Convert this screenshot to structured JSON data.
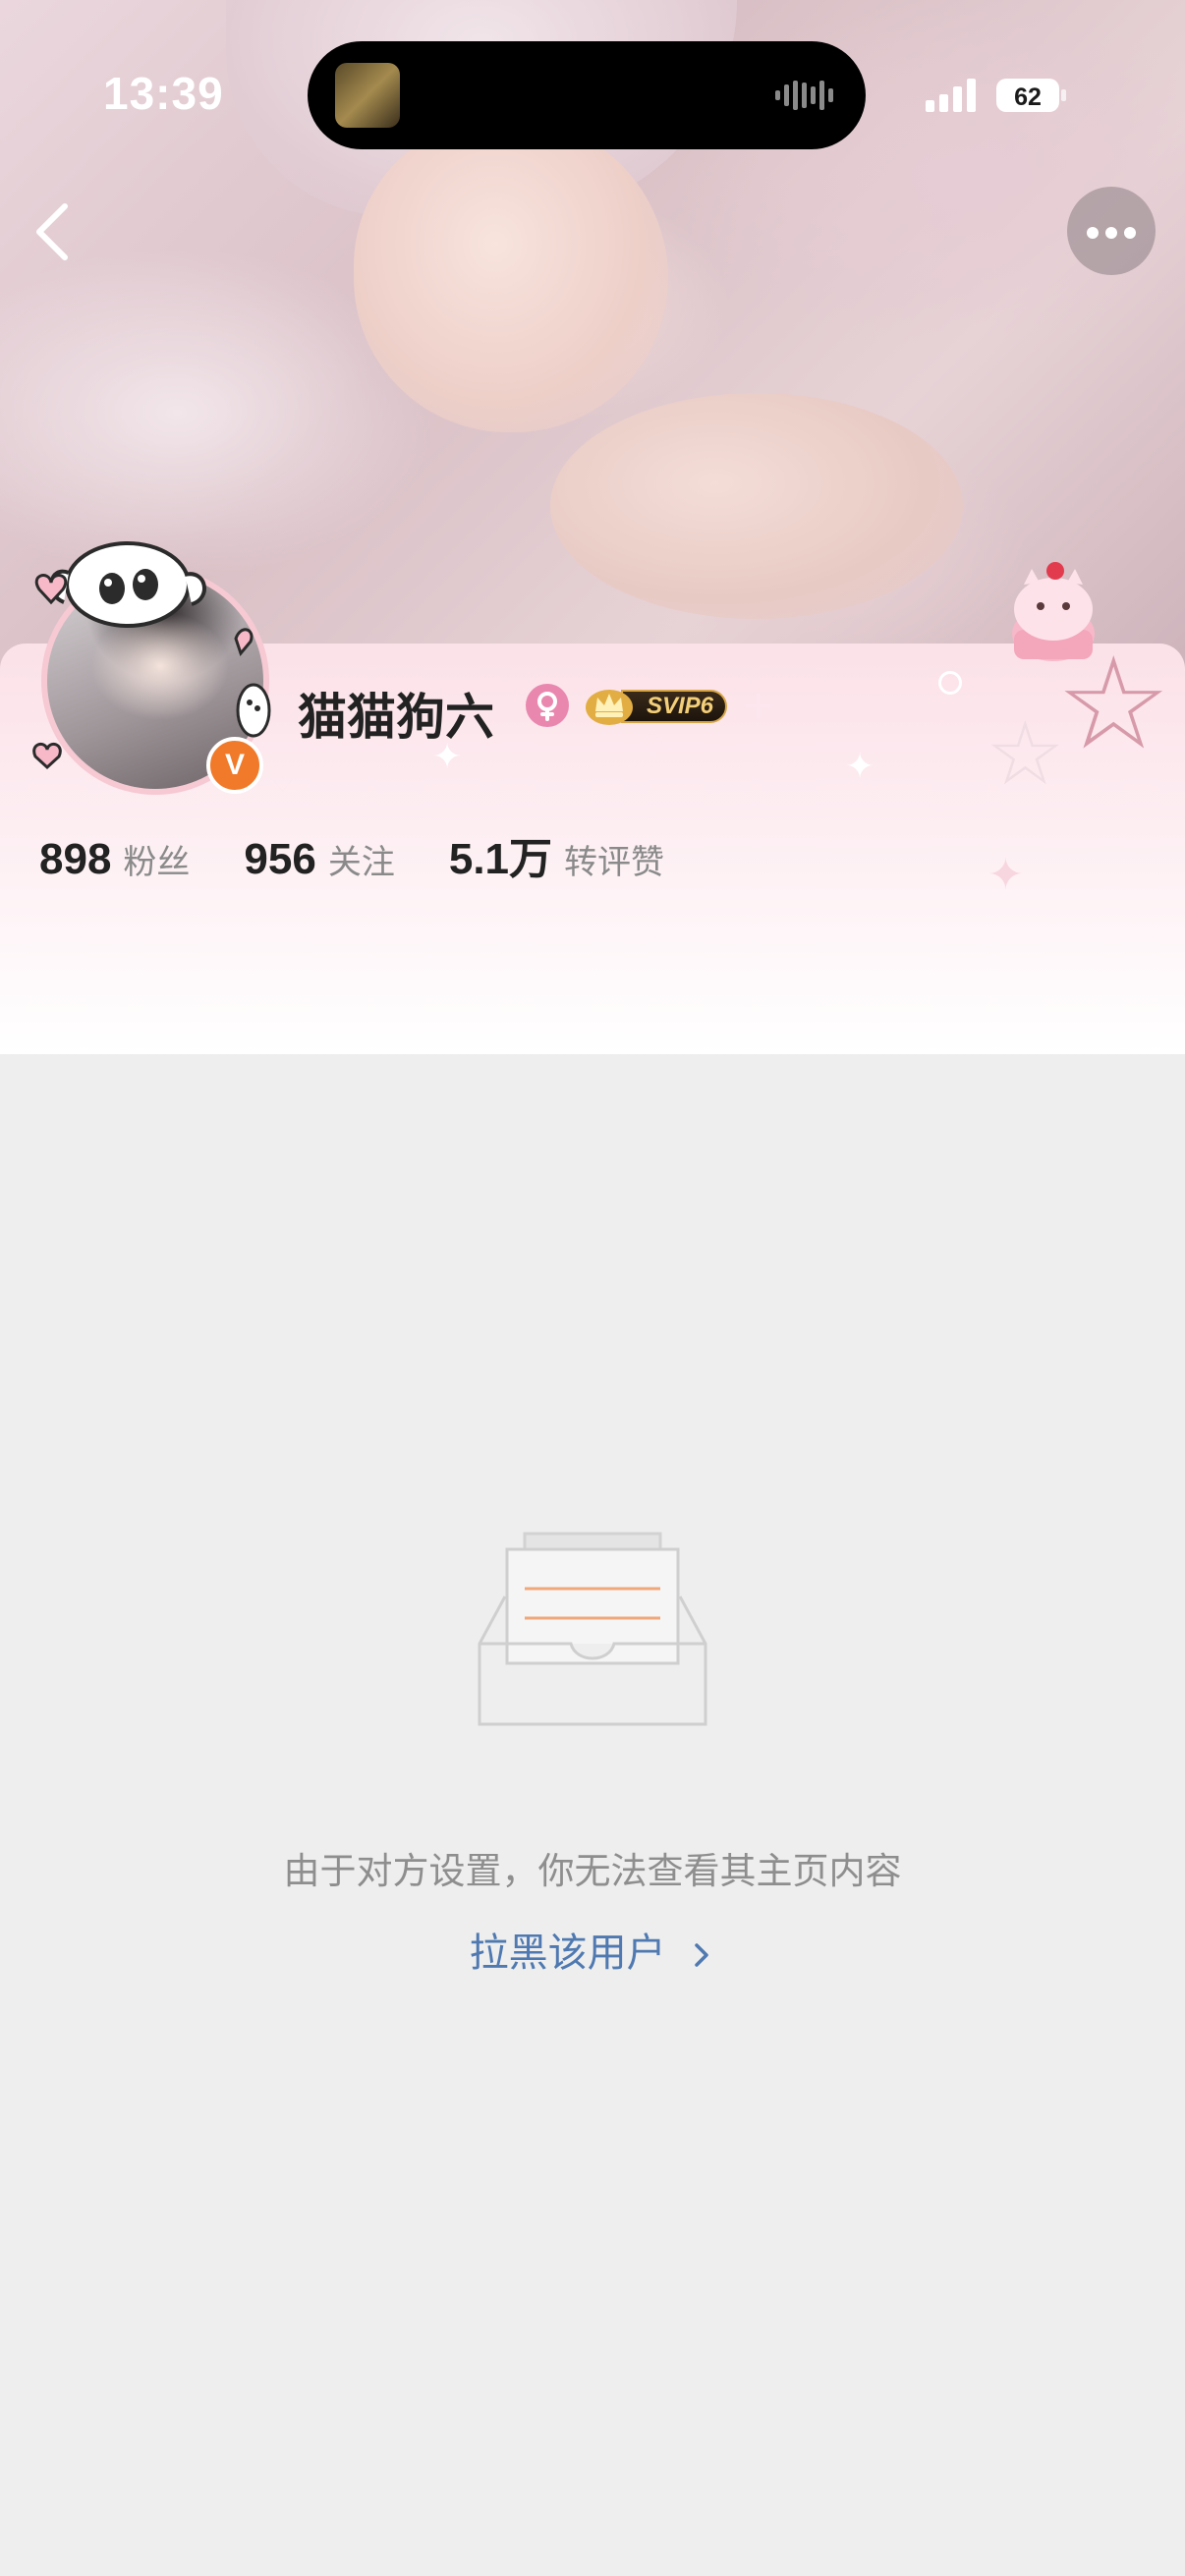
{
  "status_bar": {
    "time": "13:39",
    "battery_level": "62"
  },
  "colors": {
    "accent_link": "#4f79b0",
    "verified_badge": "#f07a2a",
    "gender_female": "#e987ae",
    "page_background": "#eeeeee"
  },
  "header": {
    "back_icon": "chevron-left-icon",
    "more_icon": "more-dots-icon"
  },
  "profile": {
    "name": "猫猫狗六",
    "gender_icon": "female-icon",
    "vip_badge": "SVIP6",
    "verified_icon": "verified-v-icon",
    "verified_mark": "V",
    "stats": [
      {
        "value": "898",
        "label": "粉丝"
      },
      {
        "value": "956",
        "label": "关注"
      },
      {
        "value": "5.1万",
        "label": "转评赞"
      }
    ]
  },
  "empty_state": {
    "illustration_icon": "empty-inbox-icon",
    "message": "由于对方设置，你无法查看其主页内容",
    "action_label": "拉黑该用户"
  }
}
